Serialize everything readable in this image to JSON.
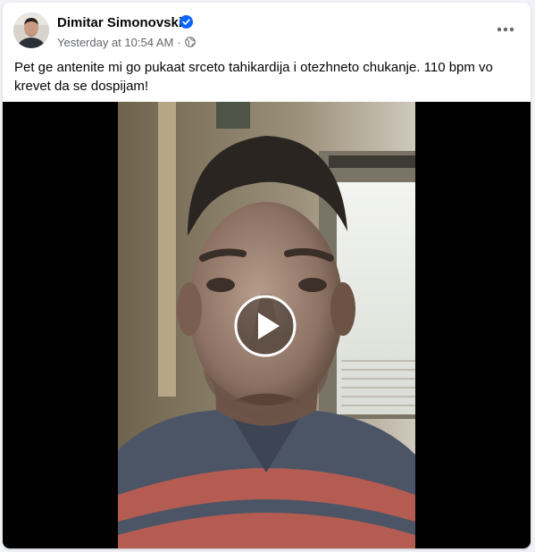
{
  "post": {
    "author": {
      "name": "Dimitar Simonovski",
      "verified": true,
      "avatar_icon": "user-avatar"
    },
    "timestamp": "Yesterday at 10:54 AM",
    "separator": "·",
    "audience_icon": "globe-icon",
    "more_icon": "more-horizontal-icon",
    "text": "Pet ge antenite mi go pukaat srceto tahikardija i otezhneto chukanje. 110 bpm vo krevet da se dospijam!",
    "video": {
      "play_icon": "play-icon"
    }
  },
  "colors": {
    "verified_badge": "#0866ff",
    "secondary_text": "#65676b",
    "primary_text": "#050505",
    "video_background": "#000000"
  }
}
